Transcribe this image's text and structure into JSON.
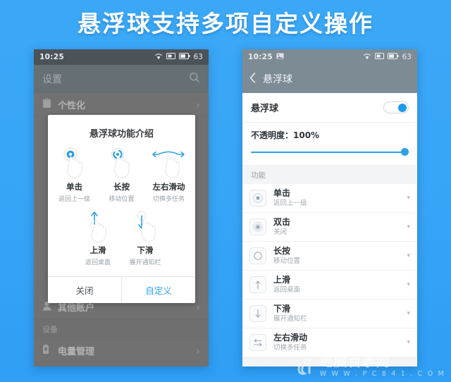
{
  "banner": {
    "title": "悬浮球支持多项自定义操作"
  },
  "status_bar": {
    "time": "10:25",
    "battery_percent": "63",
    "icons": [
      "wifi-icon",
      "sim-icon",
      "battery-icon"
    ]
  },
  "left_phone": {
    "header": {
      "title": "设置",
      "search_icon": "search-icon"
    },
    "rows": [
      {
        "label": "个性化",
        "icon": "personalization-icon",
        "chevron": "›"
      },
      {
        "label": "其他账户",
        "icon": "account-icon",
        "chevron": "›"
      },
      {
        "label": "电量管理",
        "icon": "battery-manage-icon",
        "chevron": "›"
      }
    ],
    "section_label": "设备",
    "dialog": {
      "title": "悬浮球功能介绍",
      "gestures": [
        {
          "name": "单击",
          "desc": "返回上一级",
          "icon": "tap-gesture-icon"
        },
        {
          "name": "长按",
          "desc": "移动位置",
          "icon": "long-press-gesture-icon"
        },
        {
          "name": "左右滑动",
          "desc": "切换多任务",
          "icon": "swipe-horizontal-gesture-icon"
        },
        {
          "name": "上滑",
          "desc": "返回桌面",
          "icon": "swipe-up-gesture-icon"
        },
        {
          "name": "下滑",
          "desc": "展开通知栏",
          "icon": "swipe-down-gesture-icon"
        }
      ],
      "close_label": "关闭",
      "custom_label": "自定义"
    }
  },
  "right_phone": {
    "header": {
      "back_icon": "back-arrow-icon",
      "title": "悬浮球"
    },
    "toggle": {
      "label": "悬浮球",
      "state": "on"
    },
    "opacity": {
      "label": "不透明度：100%",
      "value": 100
    },
    "section_label": "功能",
    "functions": [
      {
        "name": "单击",
        "desc": "返回上一级",
        "icon": "tap-icon",
        "caret": "▾"
      },
      {
        "name": "双击",
        "desc": "关闭",
        "icon": "double-tap-icon",
        "caret": "▾"
      },
      {
        "name": "长按",
        "desc": "移动位置",
        "icon": "long-press-icon",
        "caret": "▾"
      },
      {
        "name": "上滑",
        "desc": "返回桌面",
        "icon": "swipe-up-icon",
        "caret": "▾"
      },
      {
        "name": "下滑",
        "desc": "展开通知栏",
        "icon": "swipe-down-icon",
        "caret": "▾"
      },
      {
        "name": "左右滑动",
        "desc": "切换多任务",
        "icon": "swipe-horizontal-icon",
        "caret": "▾"
      }
    ]
  },
  "watermark": {
    "logo": "e",
    "name": "电脑百事网",
    "url": "W W W . P C 8 4 1 . C O M"
  },
  "colors": {
    "background": "#38a6f6",
    "accent": "#2aa3ef",
    "slider": "#2f9fe8"
  }
}
